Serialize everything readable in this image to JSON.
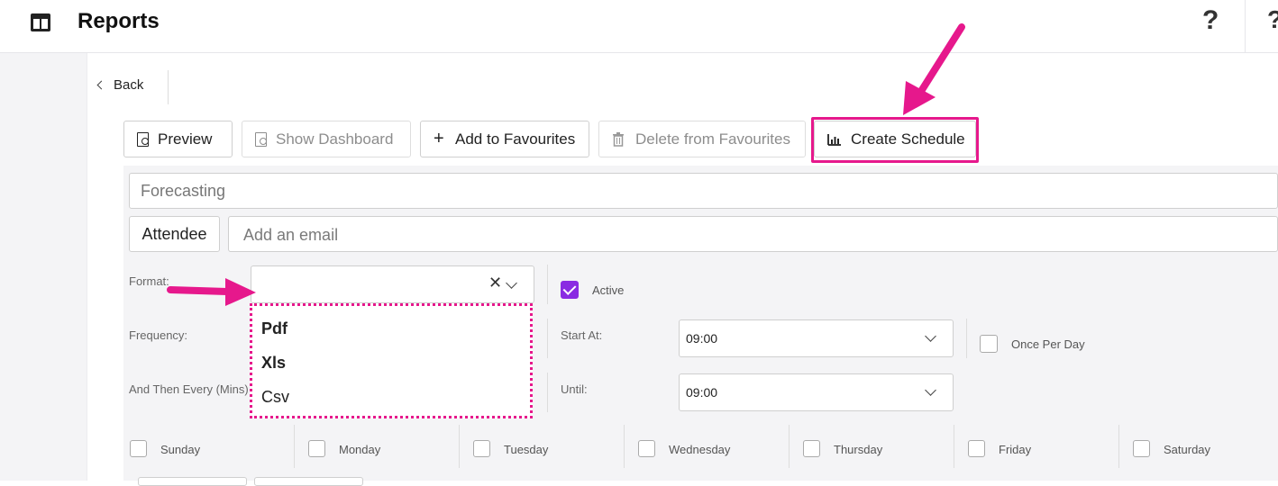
{
  "header": {
    "title": "Reports",
    "help_icon": "?",
    "right_icon": "?"
  },
  "nav": {
    "back_label": "Back"
  },
  "toolbar": {
    "preview_label": "Preview",
    "show_dashboard_label": "Show Dashboard",
    "add_favourites_label": "Add to Favourites",
    "delete_favourites_label": "Delete from Favourites",
    "create_schedule_label": "Create Schedule"
  },
  "form": {
    "report_name_value": "Forecasting",
    "attendee_label": "Attendee",
    "email_placeholder": "Add an email",
    "format_label": "Format:",
    "format_clear": "✕",
    "format_options": [
      "Pdf",
      "Xls",
      "Csv"
    ],
    "active_label": "Active",
    "frequency_label": "Frequency:",
    "start_at_label": "Start At:",
    "start_at_value": "09:00",
    "once_per_day_label": "Once Per Day",
    "then_every_label": "And Then Every (Mins):",
    "until_label": "Until:",
    "until_value": "09:00",
    "days": [
      "Sunday",
      "Monday",
      "Tuesday",
      "Wednesday",
      "Thursday",
      "Friday",
      "Saturday"
    ]
  },
  "colors": {
    "accent": "#e6188c",
    "checkbox": "#8a2be2"
  }
}
